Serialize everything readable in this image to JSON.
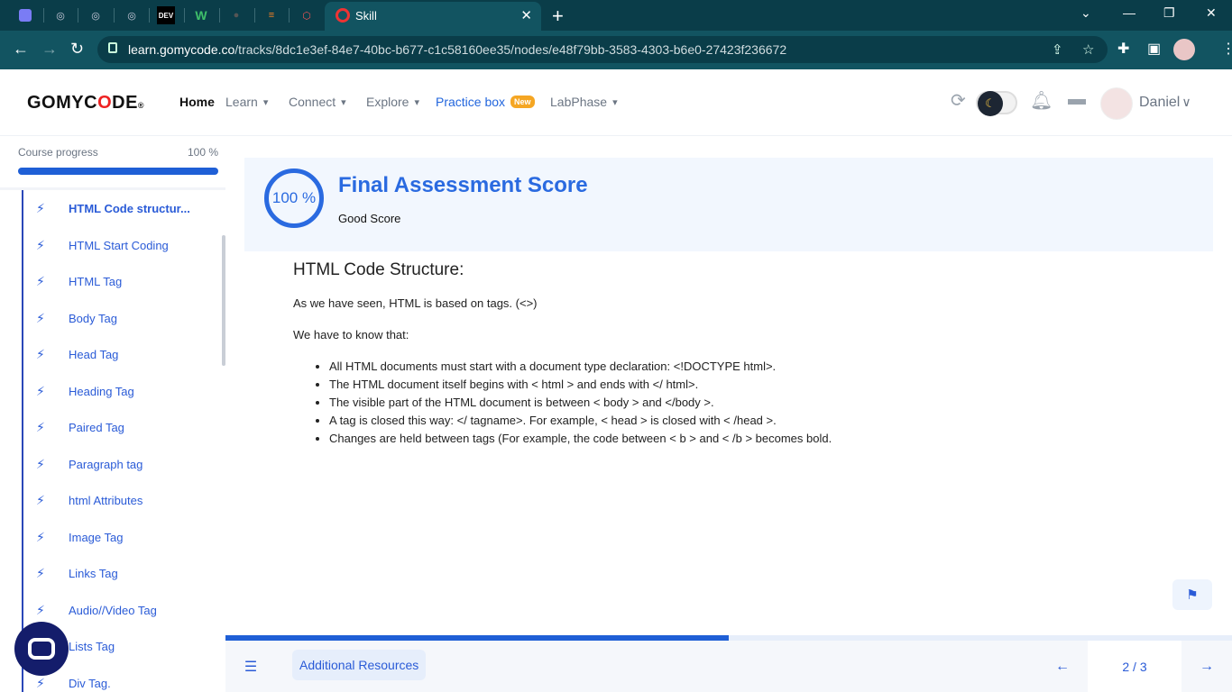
{
  "browser": {
    "active_tab_title": "Skill",
    "url_host": "learn.gomycode.co",
    "url_path": "/tracks/8dc1e3ef-84e7-40bc-b677-c1c58160ee35/nodes/e48f79bb-3583-4303-b6e0-27423f236672",
    "pinned_tab_dev_label": "DEV",
    "pinned_tab_w_label": "W"
  },
  "header": {
    "logo_prefix": "GOMYC",
    "logo_red": "O",
    "logo_suffix": "DE",
    "logo_mark": "®",
    "nav": {
      "home": "Home",
      "learn": "Learn",
      "connect": "Connect",
      "explore": "Explore",
      "practice": "Practice box",
      "practice_badge": "New",
      "labphase": "LabPhase"
    },
    "user_name": "Daniel"
  },
  "sidebar": {
    "progress_label": "Course progress",
    "progress_value": "100 %",
    "progress_fraction": 1.0,
    "items": [
      {
        "label": "HTML Code structur...",
        "active": true
      },
      {
        "label": "HTML Start Coding"
      },
      {
        "label": "HTML Tag"
      },
      {
        "label": "Body Tag"
      },
      {
        "label": "Head Tag"
      },
      {
        "label": "Heading Tag"
      },
      {
        "label": "Paired Tag"
      },
      {
        "label": "Paragraph tag"
      },
      {
        "label": "html Attributes"
      },
      {
        "label": "Image Tag"
      },
      {
        "label": "Links Tag"
      },
      {
        "label": "Audio//Video Tag"
      },
      {
        "label": "Lists Tag"
      },
      {
        "label": "Div Tag."
      }
    ]
  },
  "score": {
    "value": "100 %",
    "title": "Final Assessment Score",
    "subtitle": "Good Score"
  },
  "content": {
    "heading": "HTML Code Structure:",
    "intro": "As we have seen, HTML is based on tags. (<>)",
    "lead": "We have to know that:",
    "bullets": [
      "All HTML documents must start with a document type declaration: <!DOCTYPE html>.",
      "The HTML document itself begins with < html > and ends with </ html>.",
      "The visible part of the HTML document is between < body > and </body >.",
      "A tag is closed this way: </ tagname>. For example, < head > is closed with < /head >.",
      "Changes are held between tags (For example, the code between < b > and < /b > becomes bold."
    ]
  },
  "footer": {
    "additional_resources": "Additional Resources",
    "page": "2 / 3",
    "lesson_progress_fraction": 0.5
  },
  "colors": {
    "brand_blue": "#2a6ae0",
    "browser_dark": "#0a3d49",
    "browser_toolbar": "#125461",
    "logo_red": "#e22",
    "badge_orange": "#f5a623"
  },
  "icons": {
    "sidebar_item": "bolt-icon",
    "flag": "flag-icon",
    "chat": "chat-icon"
  }
}
